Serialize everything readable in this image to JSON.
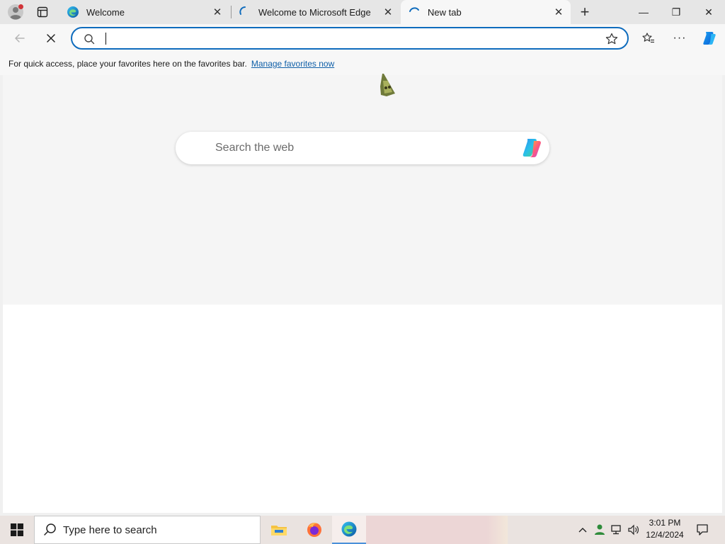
{
  "browser": {
    "tabs": [
      {
        "title": "Welcome",
        "close_glyph": "✕",
        "icon": "edge-logo-icon",
        "state": "inactive"
      },
      {
        "title": "Welcome to Microsoft Edge",
        "close_glyph": "✕",
        "icon": "loading-spinner-icon",
        "state": "inactive"
      },
      {
        "title": "New tab",
        "close_glyph": "✕",
        "icon": "loading-spinner-icon",
        "state": "active"
      }
    ],
    "new_tab_glyph": "+",
    "window_controls": {
      "minimize": "—",
      "restore": "❐",
      "close": "✕"
    }
  },
  "toolbar": {
    "address_value": "",
    "stop_glyph": "✕",
    "more_glyph": "···"
  },
  "favorites_bar": {
    "message": "For quick access, place your favorites here on the favorites bar.",
    "link": "Manage favorites now"
  },
  "new_tab_page": {
    "search_placeholder": "Search the web"
  },
  "taskbar": {
    "search_placeholder": "Type here to search",
    "apps": [
      "file-explorer-icon",
      "firefox-icon",
      "edge-icon"
    ],
    "active_app": "edge-icon",
    "tray_chevron": "^",
    "clock_time": "3:01 PM",
    "clock_date": "12/4/2024"
  },
  "colors": {
    "accent": "#0f6cbd",
    "link": "#0f5fa8",
    "tabstrip": "#e6e6e6",
    "toolbar": "#f7f7f7",
    "ntp_background": "#f5f5f5"
  }
}
